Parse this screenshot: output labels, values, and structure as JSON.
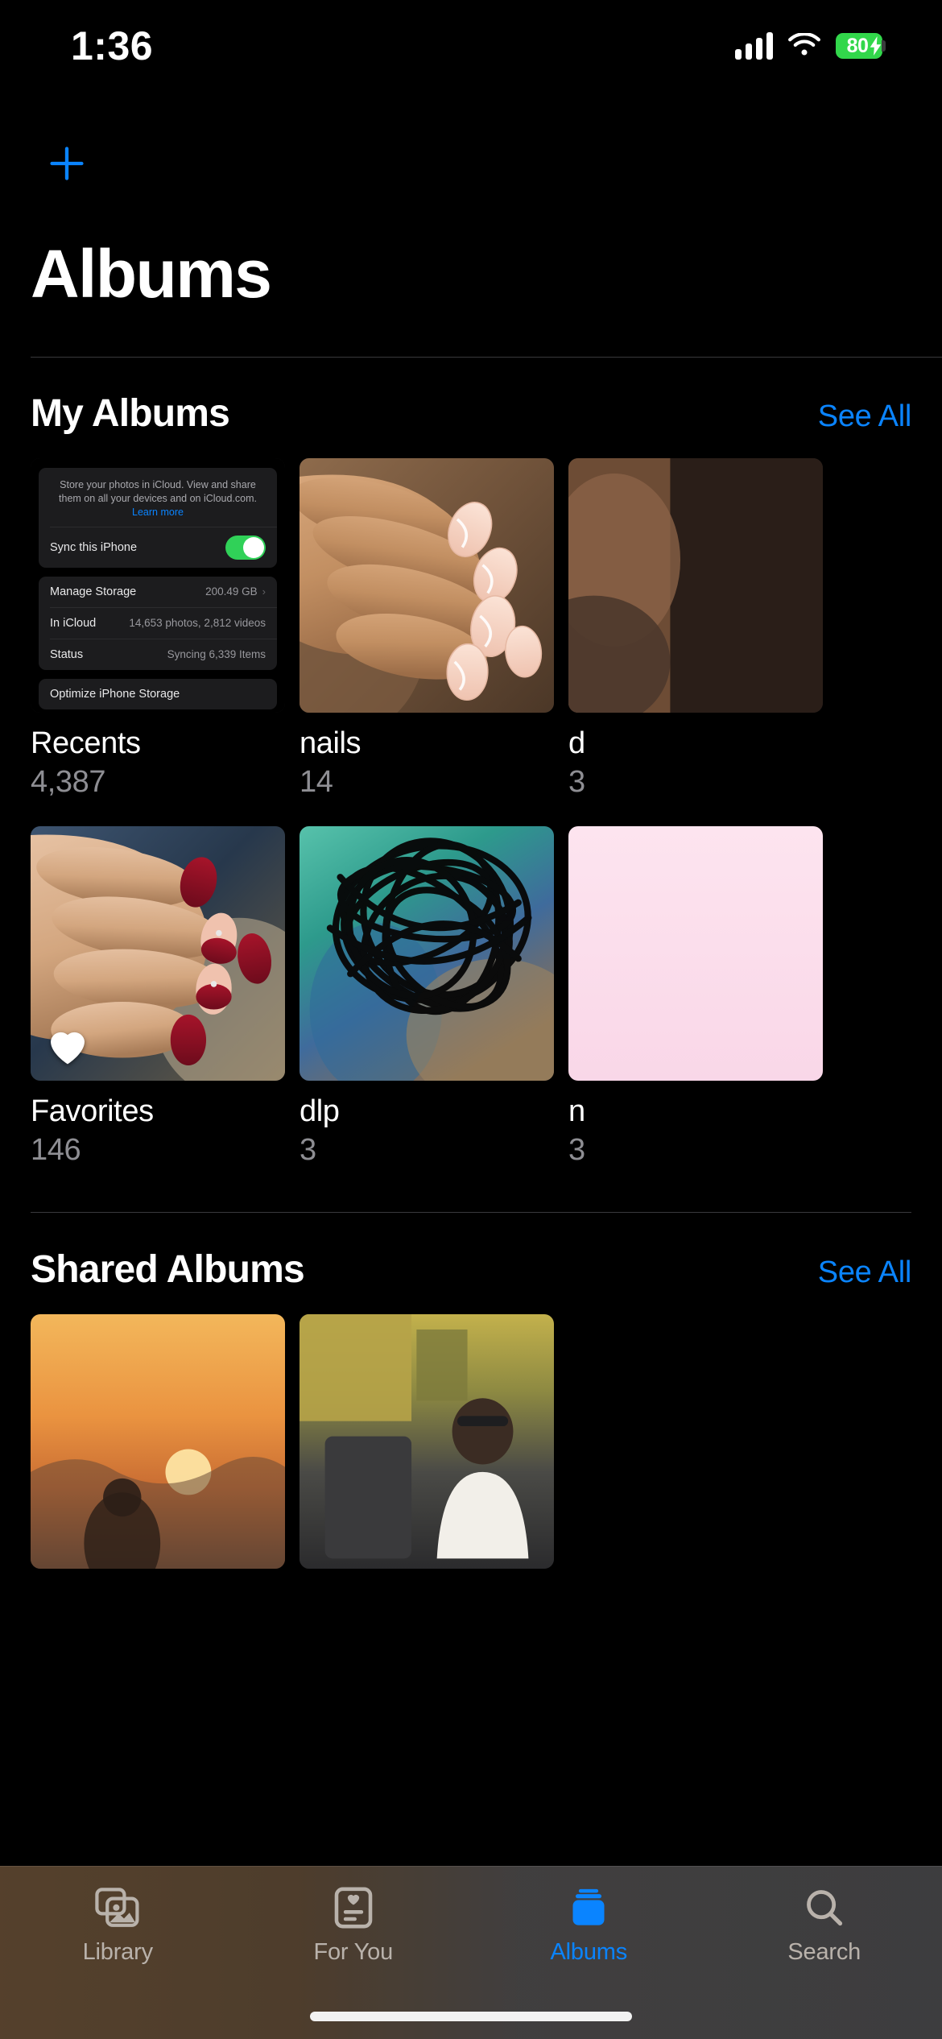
{
  "status_bar": {
    "time": "1:36",
    "battery_percent": "80",
    "battery_color": "#32d74b",
    "icons": [
      "cellular-signal-icon",
      "wifi-icon",
      "battery-charging-icon"
    ]
  },
  "nav": {
    "add_icon": "plus-icon",
    "title": "Albums"
  },
  "accent_color": "#0a84ff",
  "sections": [
    {
      "title": "My Albums",
      "see_all": "See All",
      "rows": [
        [
          {
            "name": "Recents",
            "count": "4,387",
            "thumb": "icloud-settings-screenshot"
          },
          {
            "name": "nails",
            "count": "14",
            "thumb": "photo-nails-hand"
          },
          {
            "name": "d",
            "count": "3",
            "thumb": "photo-partial"
          }
        ],
        [
          {
            "name": "Favorites",
            "count": "146",
            "thumb": "photo-red-nails",
            "badge": "heart-icon"
          },
          {
            "name": "dlp",
            "count": "3",
            "thumb": "photo-scribble"
          },
          {
            "name": "n",
            "count": "3",
            "thumb": "photo-pink-card"
          }
        ]
      ]
    },
    {
      "title": "Shared Albums",
      "see_all": "See All",
      "rows": [
        [
          {
            "name": "",
            "count": "",
            "thumb": "photo-sunset"
          },
          {
            "name": "",
            "count": "",
            "thumb": "photo-street"
          }
        ]
      ]
    }
  ],
  "recents_thumbnail": {
    "description_line_1": "Store your photos in iCloud. View and share",
    "description_line_2": "them on all your devices and on iCloud.com.",
    "learn_more": "Learn more",
    "sync_label": "Sync this iPhone",
    "sync_enabled": true,
    "rows": [
      {
        "label": "Manage Storage",
        "value": "200.49 GB",
        "chevron": "chevron-right-icon"
      },
      {
        "label": "In iCloud",
        "value": "14,653 photos, 2,812 videos",
        "chevron": ""
      },
      {
        "label": "Status",
        "value": "Syncing 6,339 Items",
        "chevron": ""
      }
    ],
    "optimize_label": "Optimize iPhone Storage"
  },
  "tab_bar": {
    "tabs": [
      {
        "label": "Library",
        "icon": "photo-stack-icon",
        "active": false
      },
      {
        "label": "For You",
        "icon": "heart-card-icon",
        "active": false
      },
      {
        "label": "Albums",
        "icon": "albums-stack-icon",
        "active": true
      },
      {
        "label": "Search",
        "icon": "magnifier-icon",
        "active": false
      }
    ]
  }
}
